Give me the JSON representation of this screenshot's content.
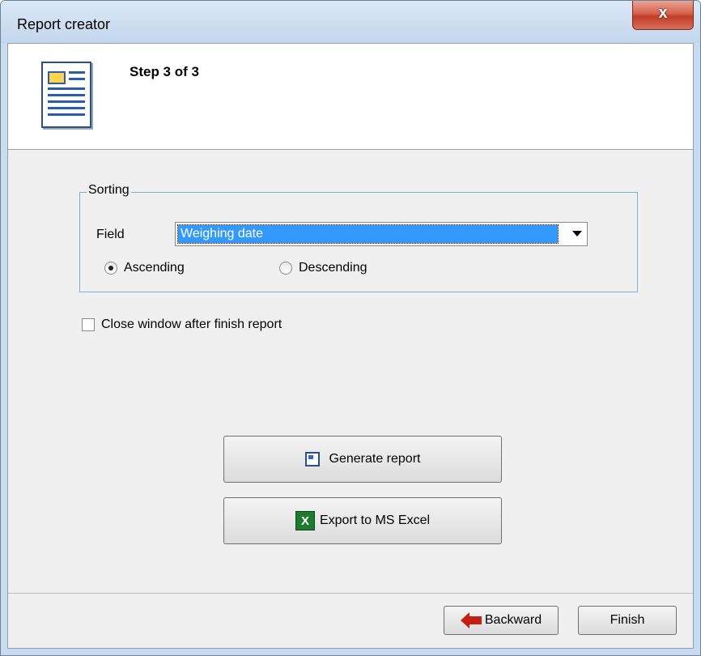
{
  "window": {
    "title": "Report creator",
    "close_label": "x"
  },
  "header": {
    "step": "Step 3 of 3",
    "icon": "report-document-icon"
  },
  "sorting": {
    "group_title": "Sorting",
    "field_label": "Field",
    "field_value": "Weighing date",
    "ascending_label": "Ascending",
    "descending_label": "Descending",
    "selected": "Ascending"
  },
  "options": {
    "close_after_finish_label": "Close window after finish report",
    "close_after_finish_checked": false
  },
  "actions": {
    "generate_label": "Generate report",
    "export_label": "Export to MS Excel",
    "excel_glyph": "X"
  },
  "footer": {
    "backward_label": "Backward",
    "finish_label": "Finish"
  }
}
